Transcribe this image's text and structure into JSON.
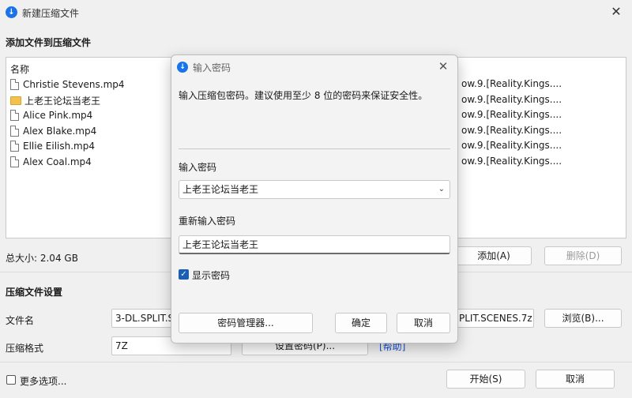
{
  "window": {
    "title": "新建压缩文件",
    "logo_glyph": "↓",
    "close_glyph": "✕"
  },
  "files_section": {
    "title": "添加文件到压缩文件",
    "list_header": "名称",
    "items": [
      {
        "name": "Christie Stevens.mp4",
        "type": "file",
        "path": "ow.9.[Reality.Kings...."
      },
      {
        "name": "上老王论坛当老王",
        "type": "folder",
        "path": "ow.9.[Reality.Kings...."
      },
      {
        "name": "Alice Pink.mp4",
        "type": "file",
        "path": "ow.9.[Reality.Kings...."
      },
      {
        "name": "Alex Blake.mp4",
        "type": "file",
        "path": "ow.9.[Reality.Kings...."
      },
      {
        "name": "Ellie Eilish.mp4",
        "type": "file",
        "path": "ow.9.[Reality.Kings...."
      },
      {
        "name": "Alex Coal.mp4",
        "type": "file",
        "path": "ow.9.[Reality.Kings...."
      }
    ],
    "total_size": "总大小: 2.04 GB",
    "add_button": "添加(A)",
    "remove_button": "删除(D)"
  },
  "settings_section": {
    "title": "压缩文件设置",
    "filename_label": "文件名",
    "filename_value_left": "3-DL.SPLIT.S",
    "filename_value_right": "PLIT.SCENES.7z",
    "browse_button": "浏览(B)...",
    "format_label": "压缩格式",
    "format_value": "7Z",
    "set_password_button": "设置密码(P)...",
    "help_link": "[帮助]"
  },
  "footer": {
    "more_options": "更多选项...",
    "start_button": "开始(S)",
    "cancel_button": "取消"
  },
  "password_dialog": {
    "title": "输入密码",
    "logo_glyph": "↓",
    "close_glyph": "✕",
    "description": "输入压缩包密码。建议使用至少 8 位的密码来保证安全性。",
    "password_label": "输入密码",
    "password_value": "上老王论坛当老王",
    "reenter_label": "重新输入密码",
    "reenter_value": "上老王论坛当老王",
    "show_password_label": "显示密码",
    "show_password_checked": true,
    "check_glyph": "✓",
    "dropdown_glyph": "⌄",
    "manager_button": "密码管理器...",
    "ok_button": "确定",
    "cancel_button": "取消",
    "accent_color": "#1a5fb4"
  }
}
